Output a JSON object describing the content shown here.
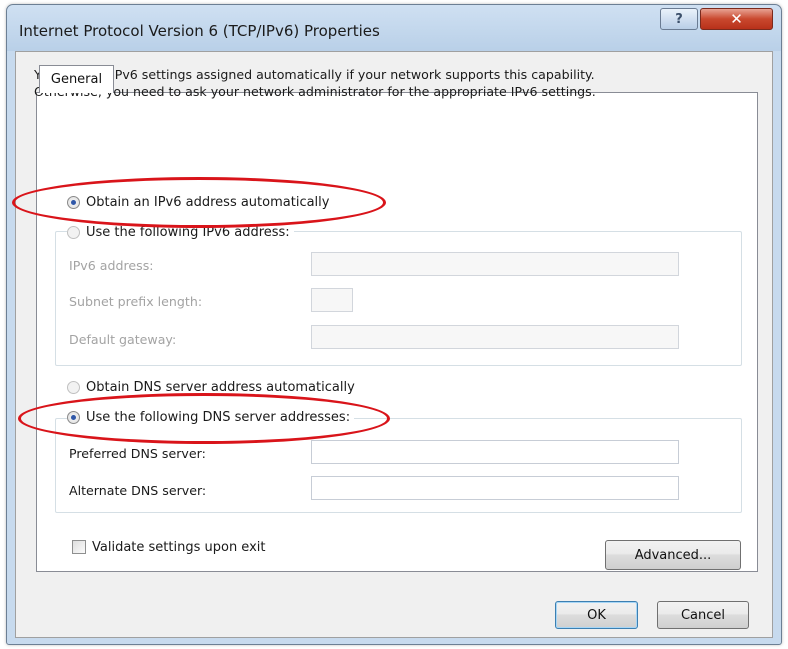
{
  "window": {
    "title": "Internet Protocol Version 6 (TCP/IPv6) Properties",
    "help_glyph": "?",
    "close_glyph": "✕"
  },
  "tabs": [
    {
      "label": "General"
    }
  ],
  "description": {
    "line1": "You can get IPv6 settings assigned automatically if your network supports this capability.",
    "line2": "Otherwise, you need to ask your network administrator for the appropriate IPv6 settings."
  },
  "ip_mode": {
    "auto_label": "Obtain an IPv6 address automatically",
    "manual_label": "Use the following IPv6 address:",
    "selected": "auto"
  },
  "ip_fields": {
    "address_label": "IPv6 address:",
    "address_value": "",
    "prefix_label": "Subnet prefix length:",
    "prefix_value": "",
    "gateway_label": "Default gateway:",
    "gateway_value": ""
  },
  "dns_mode": {
    "auto_label": "Obtain DNS server address automatically",
    "manual_label": "Use the following DNS server addresses:",
    "selected": "manual"
  },
  "dns_fields": {
    "preferred_label": "Preferred DNS server:",
    "preferred_value": "",
    "alternate_label": "Alternate DNS server:",
    "alternate_value": ""
  },
  "validate": {
    "label": "Validate settings upon exit",
    "checked": false
  },
  "buttons": {
    "advanced": "Advanced...",
    "ok": "OK",
    "cancel": "Cancel"
  },
  "colors": {
    "annotation_red": "#d9141a",
    "radio_selected": "#2f57a8"
  }
}
